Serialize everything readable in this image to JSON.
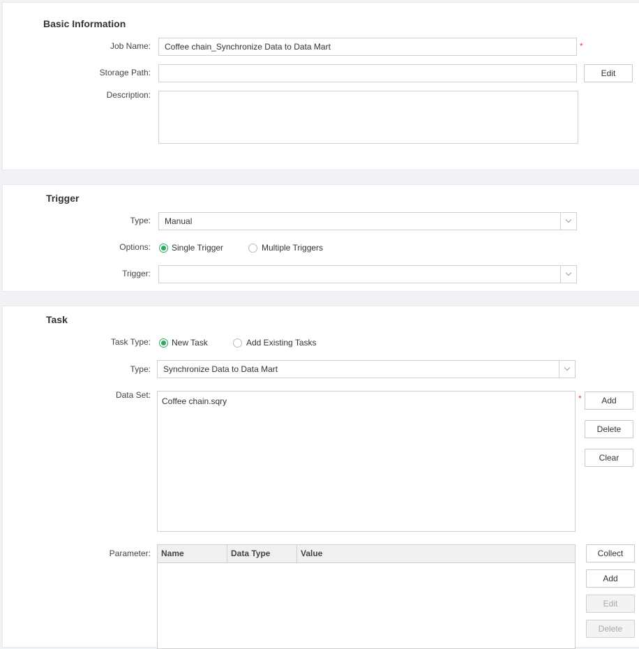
{
  "basic": {
    "title": "Basic Information",
    "job_name_label": "Job Name:",
    "job_name_value": "Coffee chain_Synchronize Data to Data Mart",
    "storage_path_label": "Storage Path:",
    "storage_path_value": "",
    "edit_label": "Edit",
    "description_label": "Description:",
    "required_mark": "*"
  },
  "trigger": {
    "title": "Trigger",
    "type_label": "Type:",
    "type_value": "Manual",
    "options_label": "Options:",
    "option_single": "Single Trigger",
    "option_multiple": "Multiple Triggers",
    "trigger_label": "Trigger:",
    "trigger_value": ""
  },
  "task": {
    "title": "Task",
    "task_type_label": "Task Type:",
    "task_type_new": "New Task",
    "task_type_existing": "Add Existing Tasks",
    "type_label": "Type:",
    "type_value": "Synchronize Data to Data Mart",
    "dataset_label": "Data Set:",
    "datasets": [
      "Coffee chain.sqry"
    ],
    "dataset_buttons": {
      "add": "Add",
      "delete": "Delete",
      "clear": "Clear"
    },
    "parameter_label": "Parameter:",
    "parameter_columns": [
      "Name",
      "Data Type",
      "Value"
    ],
    "parameter_buttons": {
      "collect": "Collect",
      "add": "Add",
      "edit": "Edit",
      "delete": "Delete"
    }
  },
  "colors": {
    "accent": "#2eaa5e",
    "required": "#e0432b"
  }
}
